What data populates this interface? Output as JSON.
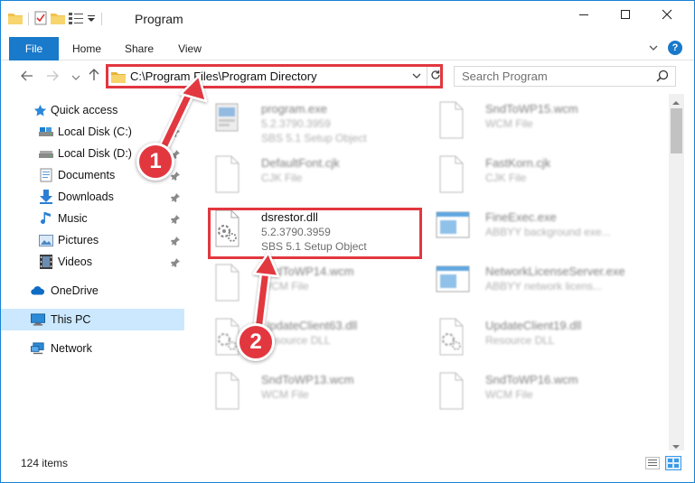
{
  "window": {
    "title": "Program",
    "controls": {
      "minimize": "minimize",
      "maximize": "maximize",
      "close": "close"
    }
  },
  "ribbon": {
    "tabs": [
      "File",
      "Home",
      "Share",
      "View"
    ],
    "help_label": "?"
  },
  "address": {
    "path": "C:\\Program Files\\Program Directory"
  },
  "search": {
    "placeholder": "Search Program"
  },
  "sidebar": {
    "items": [
      {
        "label": "Quick access",
        "icon": "star-icon",
        "pinned": false
      },
      {
        "label": "Local Disk (C:)",
        "icon": "drive-icon",
        "pinned": true
      },
      {
        "label": "Local Disk (D:)",
        "icon": "drive-icon",
        "pinned": true
      },
      {
        "label": "Documents",
        "icon": "documents-icon",
        "pinned": true
      },
      {
        "label": "Downloads",
        "icon": "downloads-icon",
        "pinned": true
      },
      {
        "label": "Music",
        "icon": "music-icon",
        "pinned": true
      },
      {
        "label": "Pictures",
        "icon": "pictures-icon",
        "pinned": true
      },
      {
        "label": "Videos",
        "icon": "videos-icon",
        "pinned": true
      },
      {
        "label": "OneDrive",
        "icon": "cloud-icon",
        "pinned": false
      },
      {
        "label": "This PC",
        "icon": "computer-icon",
        "pinned": false,
        "selected": true
      },
      {
        "label": "Network",
        "icon": "network-icon",
        "pinned": false
      }
    ]
  },
  "files": [
    {
      "name": "program.exe",
      "line2": "5.2.3790.3959",
      "line3": "SBS 5.1 Setup Object",
      "icon": "installer-icon"
    },
    {
      "name": "SndToWP15.wcm",
      "line2": "WCM File",
      "line3": "",
      "icon": "file-icon"
    },
    {
      "name": "DefaultFont.cjk",
      "line2": "CJK File",
      "line3": "",
      "icon": "file-icon"
    },
    {
      "name": "FastKorn.cjk",
      "line2": "CJK File",
      "line3": "",
      "icon": "file-icon"
    },
    {
      "name": "dsrestor.dll",
      "line2": "5.2.3790.3959",
      "line3": "SBS 5.1 Setup Object",
      "icon": "dll-icon"
    },
    {
      "name": "FineExec.exe",
      "line2": "ABBYY background exe...",
      "line3": "",
      "icon": "window-app-icon"
    },
    {
      "name": "SndToWP14.wcm",
      "line2": "WCM File",
      "line3": "",
      "icon": "file-icon"
    },
    {
      "name": "NetworkLicenseServer.exe",
      "line2": "ABBYY network licens...",
      "line3": "",
      "icon": "window-app-icon"
    },
    {
      "name": "UpdateClient63.dll",
      "line2": "Resource DLL",
      "line3": "",
      "icon": "dll-icon"
    },
    {
      "name": "UpdateClient19.dll",
      "line2": "Resource DLL",
      "line3": "",
      "icon": "dll-icon"
    },
    {
      "name": "SndToWP13.wcm",
      "line2": "WCM File",
      "line3": "",
      "icon": "file-icon"
    },
    {
      "name": "SndToWP16.wcm",
      "line2": "WCM File",
      "line3": "",
      "icon": "file-icon"
    }
  ],
  "status": {
    "item_count": "124 items"
  },
  "annotations": {
    "badge_1": "1",
    "badge_2": "2"
  },
  "colors": {
    "accent": "#1979ca",
    "highlight_red": "#e2373f",
    "selected_bg": "#cce8ff"
  }
}
